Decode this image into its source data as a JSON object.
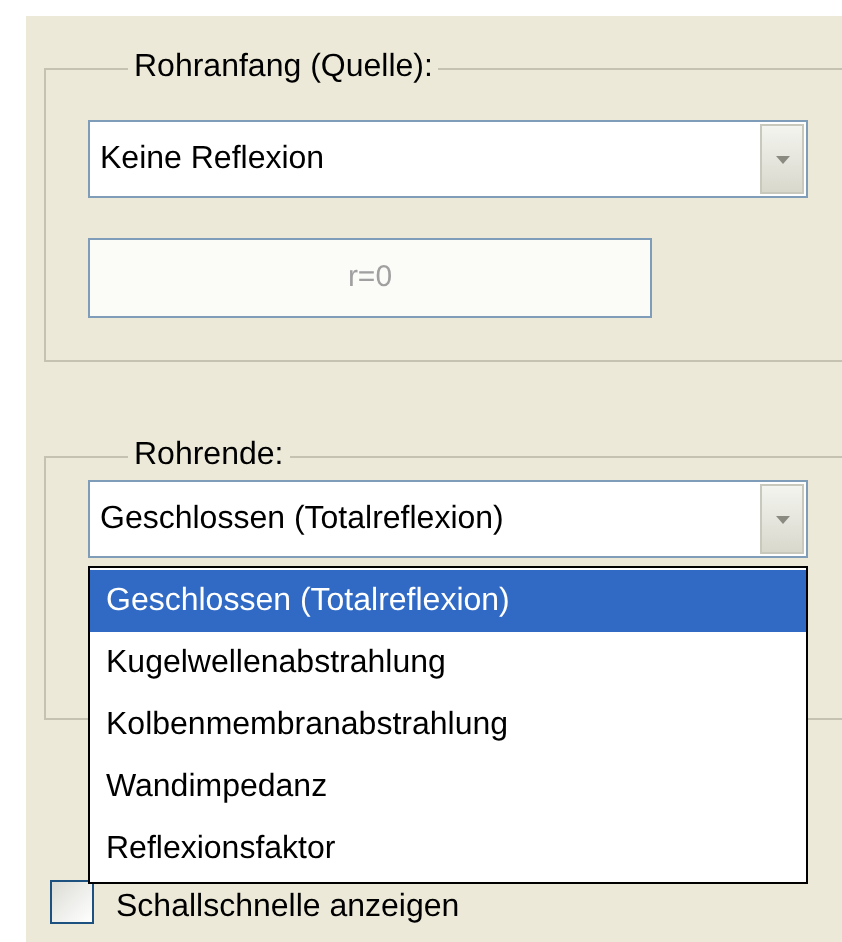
{
  "groups": [
    {
      "title": "Rohranfang (Quelle):",
      "combo": {
        "value": "Keine Reflexion"
      },
      "field": {
        "value": "r=0",
        "disabled": true
      }
    },
    {
      "title": "Rohrende:",
      "combo": {
        "value": "Geschlossen (Totalreflexion)",
        "options": [
          {
            "label": "Geschlossen (Totalreflexion)",
            "selected": true
          },
          {
            "label": "Kugelwellenabstrahlung",
            "selected": false
          },
          {
            "label": "Kolbenmembranabstrahlung",
            "selected": false
          },
          {
            "label": "Wandimpedanz",
            "selected": false
          },
          {
            "label": "Reflexionsfaktor",
            "selected": false
          }
        ]
      }
    }
  ],
  "checkbox": {
    "label": "Schallschnelle anzeigen",
    "checked": false
  }
}
